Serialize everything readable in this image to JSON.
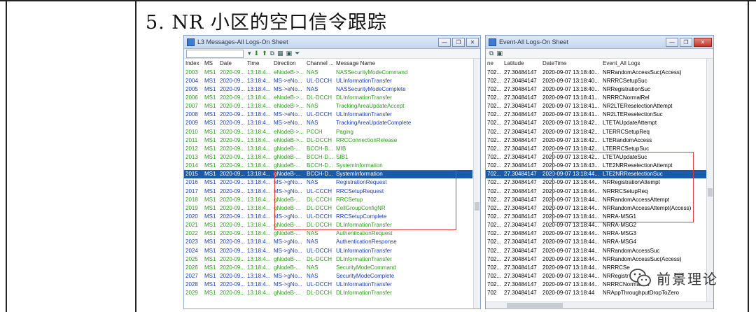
{
  "heading": "5.  NR 小区的空口信令跟踪",
  "left_window": {
    "title": "L3 Messages-All Logs-On Sheet",
    "columns": [
      "Index",
      "MS",
      "Date",
      "Time",
      "Direction",
      "Channel ...",
      "Message Name"
    ],
    "rows": [
      {
        "c": [
          "2003",
          "MS1",
          "2020-09...",
          "13:18:4...",
          "eNodeB->...",
          "NAS",
          "NASSecurityModeCommand"
        ],
        "s": "green"
      },
      {
        "c": [
          "2004",
          "MS1",
          "2020-09...",
          "13:18:4...",
          "MS->eNo...",
          "UL-DCCH",
          "ULInformationTransfer"
        ],
        "s": "blue"
      },
      {
        "c": [
          "2005",
          "MS1",
          "2020-09...",
          "13:18:4...",
          "MS->eNo...",
          "NAS",
          "NASSecurityModeComplete"
        ],
        "s": "blue"
      },
      {
        "c": [
          "2006",
          "MS1",
          "2020-09...",
          "13:18:4...",
          "eNodeB->...",
          "DL-DCCH",
          "DLInformationTransfer"
        ],
        "s": "green"
      },
      {
        "c": [
          "2007",
          "MS1",
          "2020-09...",
          "13:18:4...",
          "eNodeB->...",
          "NAS",
          "TrackingAreaUpdateAccept"
        ],
        "s": "green"
      },
      {
        "c": [
          "2008",
          "MS1",
          "2020-09...",
          "13:18:4...",
          "MS->eNo...",
          "UL-DCCH",
          "ULInformationTransfer"
        ],
        "s": "blue"
      },
      {
        "c": [
          "2009",
          "MS1",
          "2020-09...",
          "13:18:4...",
          "MS->eNo...",
          "NAS",
          "TrackingAreaUpdateComplete"
        ],
        "s": "blue"
      },
      {
        "c": [
          "2010",
          "MS1",
          "2020-09...",
          "13:18:4...",
          "eNodeB->...",
          "PCCH",
          "Paging"
        ],
        "s": "green"
      },
      {
        "c": [
          "2011",
          "MS1",
          "2020-09...",
          "13:18:4...",
          "eNodeB->...",
          "DL-DCCH",
          "RRCConnectionRelease"
        ],
        "s": "green"
      },
      {
        "c": [
          "2012",
          "MS1",
          "2020-09...",
          "13:18:4...",
          "gNodeB-...",
          "BCCH-B...",
          "MIB"
        ],
        "s": "green"
      },
      {
        "c": [
          "2013",
          "MS1",
          "2020-09...",
          "13:18:4...",
          "gNodeB-...",
          "BCCH-D...",
          "SIB1"
        ],
        "s": "green"
      },
      {
        "c": [
          "2014",
          "MS1",
          "2020-09...",
          "13:18:4...",
          "gNodeB-...",
          "BCCH-D...",
          "SystemInformation"
        ],
        "s": "green"
      },
      {
        "c": [
          "2015",
          "MS1",
          "2020-09...",
          "13:18:4...",
          "gNodeB-...",
          "BCCH-D...",
          "SystemInformation"
        ],
        "s": "sel"
      },
      {
        "c": [
          "2016",
          "MS1",
          "2020-09...",
          "13:18:4...",
          "MS->gNo...",
          "NAS",
          "RegistrationRequest"
        ],
        "s": "blue"
      },
      {
        "c": [
          "2017",
          "MS1",
          "2020-09...",
          "13:18:4...",
          "MS->gNo...",
          "UL-CCCH",
          "RRCSetupRequest"
        ],
        "s": "blue"
      },
      {
        "c": [
          "2018",
          "MS1",
          "2020-09...",
          "13:18:4...",
          "gNodeB-...",
          "DL-CCCH",
          "RRCSetup"
        ],
        "s": "green"
      },
      {
        "c": [
          "2019",
          "MS1",
          "2020-09...",
          "13:18:4...",
          "gNodeB-...",
          "DL-DCCH",
          "CellGroupConfigNR"
        ],
        "s": "green"
      },
      {
        "c": [
          "2020",
          "MS1",
          "2020-09...",
          "13:18:4...",
          "MS->gNo...",
          "UL-DCCH",
          "RRCSetupComplete"
        ],
        "s": "blue"
      },
      {
        "c": [
          "2021",
          "MS1",
          "2020-09...",
          "13:18:4...",
          "gNodeB-...",
          "DL-DCCH",
          "DLInformationTransfer"
        ],
        "s": "green"
      },
      {
        "c": [
          "2022",
          "MS1",
          "2020-09...",
          "13:18:4...",
          "gNodeB-...",
          "NAS",
          "AuthenticationRequest"
        ],
        "s": "green"
      },
      {
        "c": [
          "2023",
          "MS1",
          "2020-09...",
          "13:18:4...",
          "MS->gNo...",
          "NAS",
          "AuthenticationResponse"
        ],
        "s": "blue"
      },
      {
        "c": [
          "2024",
          "MS1",
          "2020-09...",
          "13:18:4...",
          "MS->gNo...",
          "UL-DCCH",
          "ULInformationTransfer"
        ],
        "s": "blue"
      },
      {
        "c": [
          "2025",
          "MS1",
          "2020-09...",
          "13:18:4...",
          "gNodeB-...",
          "DL-DCCH",
          "DLInformationTransfer"
        ],
        "s": "green"
      },
      {
        "c": [
          "2026",
          "MS1",
          "2020-09...",
          "13:18:4...",
          "gNodeB-...",
          "NAS",
          "SecurityModeCommand"
        ],
        "s": "green"
      },
      {
        "c": [
          "2027",
          "MS1",
          "2020-09...",
          "13:18:4...",
          "MS->gNo...",
          "NAS",
          "SecurityModeComplete"
        ],
        "s": "blue"
      },
      {
        "c": [
          "2028",
          "MS1",
          "2020-09...",
          "13:18:4...",
          "MS->gNo...",
          "UL-DCCH",
          "ULInformationTransfer"
        ],
        "s": "blue"
      },
      {
        "c": [
          "2029",
          "MS1",
          "2020-09...",
          "13:18:4...",
          "gNodeB-...",
          "DL-DCCH",
          "DLInformationTransfer"
        ],
        "s": "green"
      }
    ]
  },
  "right_window": {
    "title": "Event-All Logs-On Sheet",
    "columns": [
      "ne",
      "Latitude",
      "DateTime",
      "Event_All Logs"
    ],
    "rows": [
      {
        "c": [
          "702...",
          "27.30484147",
          "2020-09-07 13:18:40...",
          "NRRandomAccessSuc(Access)"
        ]
      },
      {
        "c": [
          "702...",
          "27.30484147",
          "2020-09-07 13:18:40...",
          "NRRRCSetupSuc"
        ]
      },
      {
        "c": [
          "702...",
          "27.30484147",
          "2020-09-07 13:18:40...",
          "NRRegistrationSuc"
        ]
      },
      {
        "c": [
          "702...",
          "27.30484147",
          "2020-09-07 13:18:41...",
          "NRRRCNormalRel"
        ]
      },
      {
        "c": [
          "702...",
          "27.30484147",
          "2020-09-07 13:18:41...",
          "NR2LTEReselectionAttempt"
        ]
      },
      {
        "c": [
          "702...",
          "27.30484147",
          "2020-09-07 13:18:41...",
          "NR2LTEReselectionSuc"
        ]
      },
      {
        "c": [
          "702...",
          "27.30484147",
          "2020-09-07 13:18:42...",
          "LTETAUpdateAttempt"
        ]
      },
      {
        "c": [
          "702...",
          "27.30484147",
          "2020-09-07 13:18:42...",
          "LTERRCSetupReq"
        ]
      },
      {
        "c": [
          "702...",
          "27.30484147",
          "2020-09-07 13:18:42...",
          "LTERandomAccess"
        ]
      },
      {
        "c": [
          "702...",
          "27.30484147",
          "2020-09-07 13:18:42...",
          "LTERRCSetupSuc"
        ]
      },
      {
        "c": [
          "702...",
          "27.30484147",
          "2020-09-07 13:18:42...",
          "LTETAUpdateSuc"
        ]
      },
      {
        "c": [
          "702...",
          "27.30484147",
          "2020-09-07 13:18:43...",
          "LTE2NRReselectionAttempt"
        ]
      },
      {
        "c": [
          "702...",
          "27.30484147",
          "2020-09-07 13:18:44...",
          "LTE2NRReselectionSuc"
        ],
        "s": "sel"
      },
      {
        "c": [
          "702...",
          "27.30484147",
          "2020-09-07 13:18:44...",
          "NRRegistrationAttempt"
        ]
      },
      {
        "c": [
          "702...",
          "27.30484147",
          "2020-09-07 13:18:44...",
          "NRRRCSetupReq"
        ]
      },
      {
        "c": [
          "702...",
          "27.30484147",
          "2020-09-07 13:18:44...",
          "NRRandomAccessAttempt"
        ]
      },
      {
        "c": [
          "702...",
          "27.30484147",
          "2020-09-07 13:18:44...",
          "NRRandomAccessAttempt(Access)"
        ]
      },
      {
        "c": [
          "702...",
          "27.30484147",
          "2020-09-07 13:18:44...",
          "NRRA-MSG1"
        ]
      },
      {
        "c": [
          "702...",
          "27.30484147",
          "2020-09-07 13:18:44...",
          "NRRA-MSG2"
        ]
      },
      {
        "c": [
          "702...",
          "27.30484147",
          "2020-09-07 13:18:44...",
          "NRRA-MSG3"
        ]
      },
      {
        "c": [
          "702...",
          "27.30484147",
          "2020-09-07 13:18:44...",
          "NRRA-MSG4"
        ]
      },
      {
        "c": [
          "702...",
          "27.30484147",
          "2020-09-07 13:18:44...",
          "NRRandomAccessSuc"
        ]
      },
      {
        "c": [
          "702...",
          "27.30484147",
          "2020-09-07 13:18:44...",
          "NRRandomAccessSuc(Access)"
        ]
      },
      {
        "c": [
          "702...",
          "27.30484147",
          "2020-09-07 13:18:44...",
          "NRRRCSe"
        ]
      },
      {
        "c": [
          "702...",
          "27.30484147",
          "2020-09-07 13:18:44...",
          "NRRegistr"
        ]
      },
      {
        "c": [
          "702...",
          "27.30484147",
          "2020-09-07 13:18:44...",
          "NRRRCNormalRel"
        ]
      },
      {
        "c": [
          "702",
          "27.30484147",
          "2020-09-07 13:18:44",
          "NRAppThroughputDropToZero"
        ]
      }
    ]
  },
  "watermark": {
    "text": "前景理论"
  },
  "colors": {
    "selected": "#1b5aa8",
    "uplink": "#1d3fae",
    "downlink": "#2e9a1f",
    "highlight": "#e03a3a"
  }
}
